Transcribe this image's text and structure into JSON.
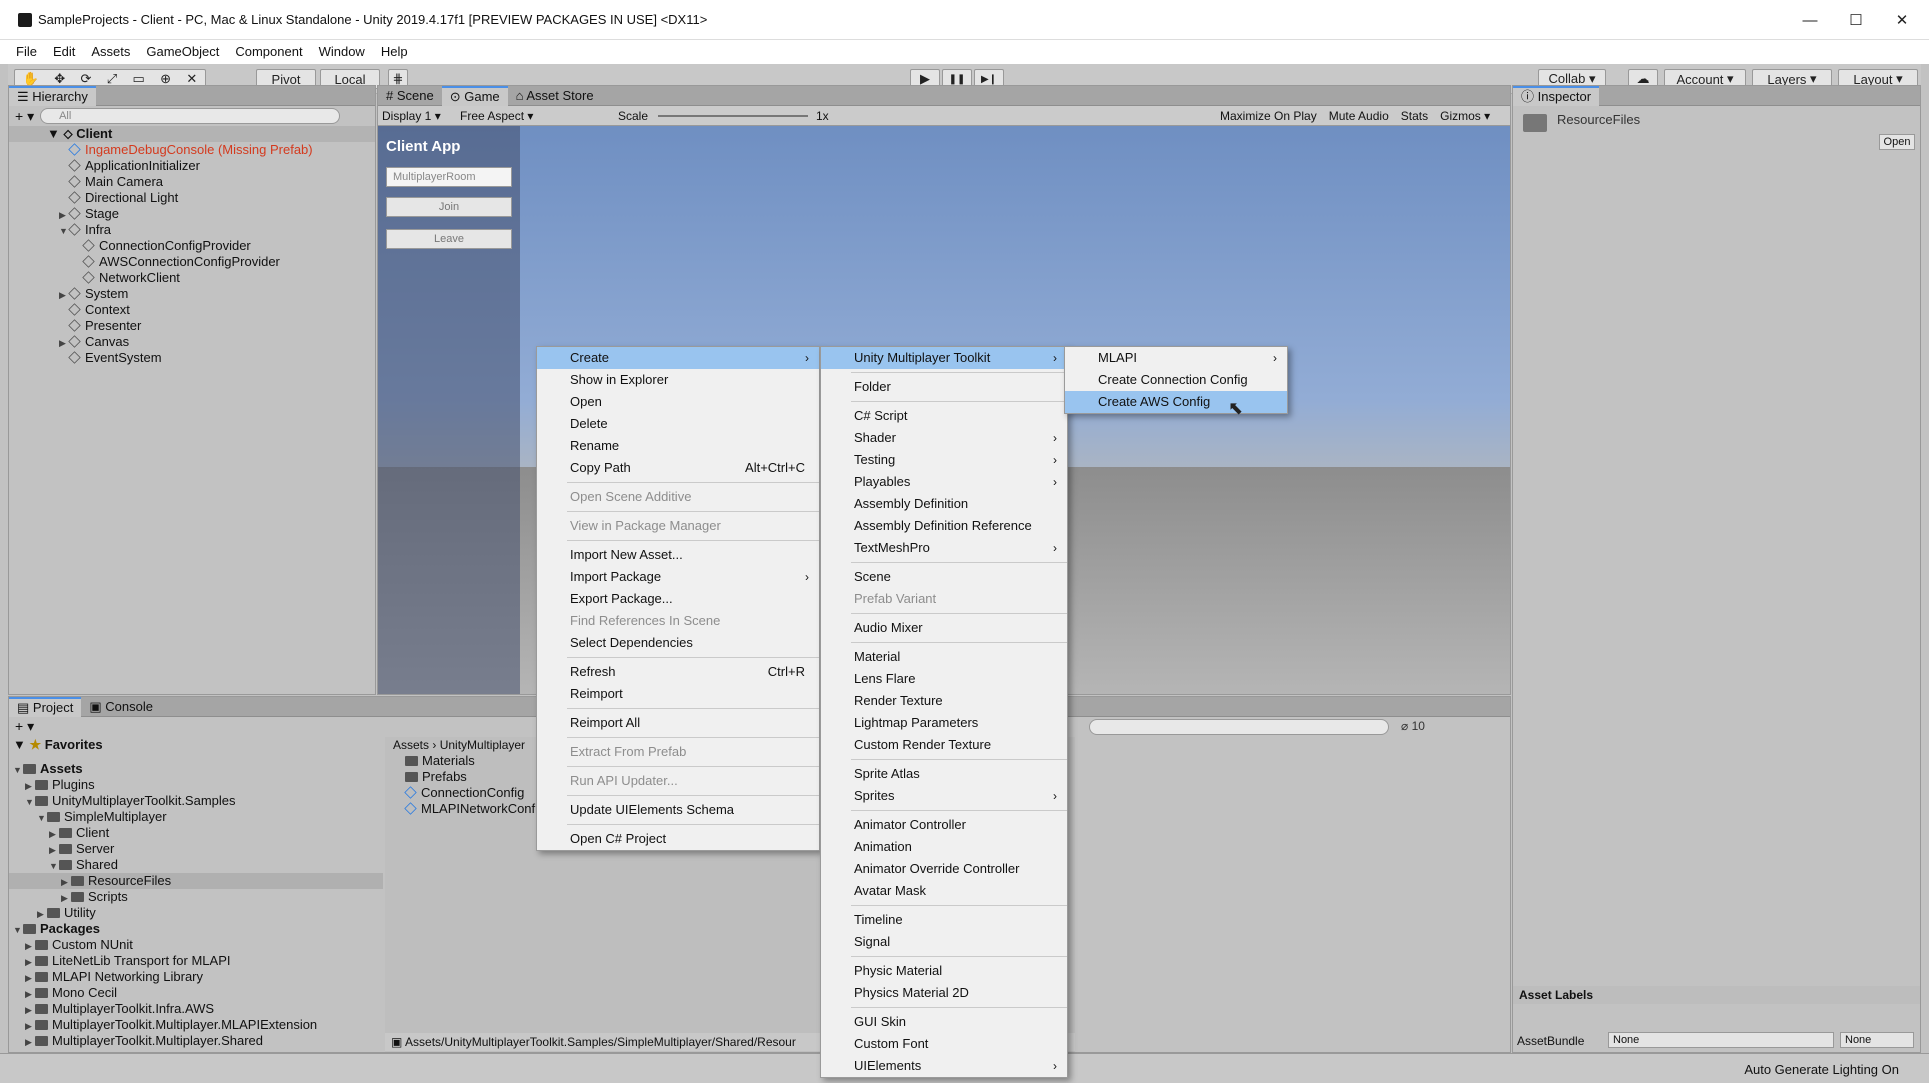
{
  "window": {
    "title": "SampleProjects - Client - PC, Mac & Linux Standalone - Unity 2019.4.17f1 [PREVIEW PACKAGES IN USE] <DX11>",
    "minimize": "—",
    "maximize": "☐",
    "close": "✕"
  },
  "menubar": [
    "File",
    "Edit",
    "Assets",
    "GameObject",
    "Component",
    "Window",
    "Help"
  ],
  "toolbar": {
    "pivot": "Pivot",
    "local": "Local",
    "collab": "Collab ▾",
    "account": "Account",
    "layers": "Layers",
    "layout": "Layout",
    "play": "▶",
    "pause": "❚❚",
    "step": "▶❙"
  },
  "hierarchy": {
    "tab": "Hierarchy",
    "search_placeholder": "All",
    "scene": "Client",
    "items": [
      {
        "label": "IngameDebugConsole (Missing Prefab)",
        "indent": 1,
        "missing": true,
        "expand": ""
      },
      {
        "label": "ApplicationInitializer",
        "indent": 1,
        "expand": ""
      },
      {
        "label": "Main Camera",
        "indent": 1,
        "expand": ""
      },
      {
        "label": "Directional Light",
        "indent": 1,
        "expand": ""
      },
      {
        "label": "Stage",
        "indent": 1,
        "expand": "▶"
      },
      {
        "label": "Infra",
        "indent": 1,
        "expand": "▼"
      },
      {
        "label": "ConnectionConfigProvider",
        "indent": 2,
        "expand": ""
      },
      {
        "label": "AWSConnectionConfigProvider",
        "indent": 2,
        "expand": ""
      },
      {
        "label": "NetworkClient",
        "indent": 2,
        "expand": ""
      },
      {
        "label": "System",
        "indent": 1,
        "expand": "▶"
      },
      {
        "label": "Context",
        "indent": 1,
        "expand": ""
      },
      {
        "label": "Presenter",
        "indent": 1,
        "expand": ""
      },
      {
        "label": "Canvas",
        "indent": 1,
        "expand": "▶"
      },
      {
        "label": "EventSystem",
        "indent": 1,
        "expand": ""
      }
    ]
  },
  "game": {
    "tabs": [
      "Scene",
      "Game",
      "Asset Store"
    ],
    "display": "Display 1",
    "aspect": "Free Aspect",
    "scale_label": "Scale",
    "scale_value": "1x",
    "maximize": "Maximize On Play",
    "mute": "Mute Audio",
    "stats": "Stats",
    "gizmos": "Gizmos",
    "client_app": {
      "title": "Client App",
      "room": "MultiplayerRoom",
      "join": "Join",
      "leave": "Leave"
    }
  },
  "inspector": {
    "tab": "Inspector",
    "asset_name": "ResourceFiles",
    "open": "Open",
    "asset_labels": "Asset Labels",
    "assetbundle": "AssetBundle",
    "bundle_value": "None",
    "variant_value": "None"
  },
  "project": {
    "tabs": [
      "Project",
      "Console"
    ],
    "favorites": "Favorites",
    "breadcrumb": [
      "Assets",
      "UnityMultiplayer"
    ],
    "count": "10",
    "tree": [
      {
        "label": "Assets",
        "indent": 0,
        "expand": "▼",
        "bold": true
      },
      {
        "label": "Plugins",
        "indent": 1,
        "expand": "▶"
      },
      {
        "label": "UnityMultiplayerToolkit.Samples",
        "indent": 1,
        "expand": "▼"
      },
      {
        "label": "SimpleMultiplayer",
        "indent": 2,
        "expand": "▼"
      },
      {
        "label": "Client",
        "indent": 3,
        "expand": "▶"
      },
      {
        "label": "Server",
        "indent": 3,
        "expand": "▶"
      },
      {
        "label": "Shared",
        "indent": 3,
        "expand": "▼"
      },
      {
        "label": "ResourceFiles",
        "indent": 4,
        "expand": "▶",
        "selected": true
      },
      {
        "label": "Scripts",
        "indent": 4,
        "expand": "▶"
      },
      {
        "label": "Utility",
        "indent": 2,
        "expand": "▶"
      },
      {
        "label": "Packages",
        "indent": 0,
        "expand": "▼",
        "bold": true
      },
      {
        "label": "Custom NUnit",
        "indent": 1,
        "expand": "▶"
      },
      {
        "label": "LiteNetLib Transport for MLAPI",
        "indent": 1,
        "expand": "▶"
      },
      {
        "label": "MLAPI Networking Library",
        "indent": 1,
        "expand": "▶"
      },
      {
        "label": "Mono Cecil",
        "indent": 1,
        "expand": "▶"
      },
      {
        "label": "MultiplayerToolkit.Infra.AWS",
        "indent": 1,
        "expand": "▶"
      },
      {
        "label": "MultiplayerToolkit.Multiplayer.MLAPIExtension",
        "indent": 1,
        "expand": "▶"
      },
      {
        "label": "MultiplayerToolkit.Multiplayer.Shared",
        "indent": 1,
        "expand": "▶"
      }
    ],
    "files": [
      {
        "label": "Materials",
        "type": "folder"
      },
      {
        "label": "Prefabs",
        "type": "folder"
      },
      {
        "label": "ConnectionConfig",
        "type": "asset"
      },
      {
        "label": "MLAPINetworkConfig",
        "type": "asset"
      }
    ],
    "path": "Assets/UnityMultiplayerToolkit.Samples/SimpleMultiplayer/Shared/Resour"
  },
  "statusbar": {
    "text": "Auto Generate Lighting On"
  },
  "context_menu": {
    "items": [
      {
        "label": "Create",
        "sub": true,
        "hl": true
      },
      {
        "label": "Show in Explorer"
      },
      {
        "label": "Open"
      },
      {
        "label": "Delete"
      },
      {
        "label": "Rename"
      },
      {
        "label": "Copy Path",
        "shortcut": "Alt+Ctrl+C"
      },
      {
        "sep": true
      },
      {
        "label": "Open Scene Additive",
        "dis": true
      },
      {
        "sep": true
      },
      {
        "label": "View in Package Manager",
        "dis": true
      },
      {
        "sep": true
      },
      {
        "label": "Import New Asset..."
      },
      {
        "label": "Import Package",
        "sub": true
      },
      {
        "label": "Export Package..."
      },
      {
        "label": "Find References In Scene",
        "dis": true
      },
      {
        "label": "Select Dependencies"
      },
      {
        "sep": true
      },
      {
        "label": "Refresh",
        "shortcut": "Ctrl+R"
      },
      {
        "label": "Reimport"
      },
      {
        "sep": true
      },
      {
        "label": "Reimport All"
      },
      {
        "sep": true
      },
      {
        "label": "Extract From Prefab",
        "dis": true
      },
      {
        "sep": true
      },
      {
        "label": "Run API Updater...",
        "dis": true
      },
      {
        "sep": true
      },
      {
        "label": "Update UIElements Schema"
      },
      {
        "sep": true
      },
      {
        "label": "Open C# Project"
      }
    ]
  },
  "create_menu": {
    "items": [
      {
        "label": "Unity Multiplayer Toolkit",
        "sub": true,
        "hl": true
      },
      {
        "sep": true
      },
      {
        "label": "Folder"
      },
      {
        "sep": true
      },
      {
        "label": "C# Script"
      },
      {
        "label": "Shader",
        "sub": true
      },
      {
        "label": "Testing",
        "sub": true
      },
      {
        "label": "Playables",
        "sub": true
      },
      {
        "label": "Assembly Definition"
      },
      {
        "label": "Assembly Definition Reference"
      },
      {
        "label": "TextMeshPro",
        "sub": true
      },
      {
        "sep": true
      },
      {
        "label": "Scene"
      },
      {
        "label": "Prefab Variant",
        "dis": true
      },
      {
        "sep": true
      },
      {
        "label": "Audio Mixer"
      },
      {
        "sep": true
      },
      {
        "label": "Material"
      },
      {
        "label": "Lens Flare"
      },
      {
        "label": "Render Texture"
      },
      {
        "label": "Lightmap Parameters"
      },
      {
        "label": "Custom Render Texture"
      },
      {
        "sep": true
      },
      {
        "label": "Sprite Atlas"
      },
      {
        "label": "Sprites",
        "sub": true
      },
      {
        "sep": true
      },
      {
        "label": "Animator Controller"
      },
      {
        "label": "Animation"
      },
      {
        "label": "Animator Override Controller"
      },
      {
        "label": "Avatar Mask"
      },
      {
        "sep": true
      },
      {
        "label": "Timeline"
      },
      {
        "label": "Signal"
      },
      {
        "sep": true
      },
      {
        "label": "Physic Material"
      },
      {
        "label": "Physics Material 2D"
      },
      {
        "sep": true
      },
      {
        "label": "GUI Skin"
      },
      {
        "label": "Custom Font"
      },
      {
        "label": "UIElements",
        "sub": true
      }
    ]
  },
  "toolkit_menu": {
    "items": [
      {
        "label": "MLAPI",
        "sub": true
      },
      {
        "label": "Create Connection Config"
      },
      {
        "label": "Create AWS Config",
        "hl": true
      }
    ]
  }
}
